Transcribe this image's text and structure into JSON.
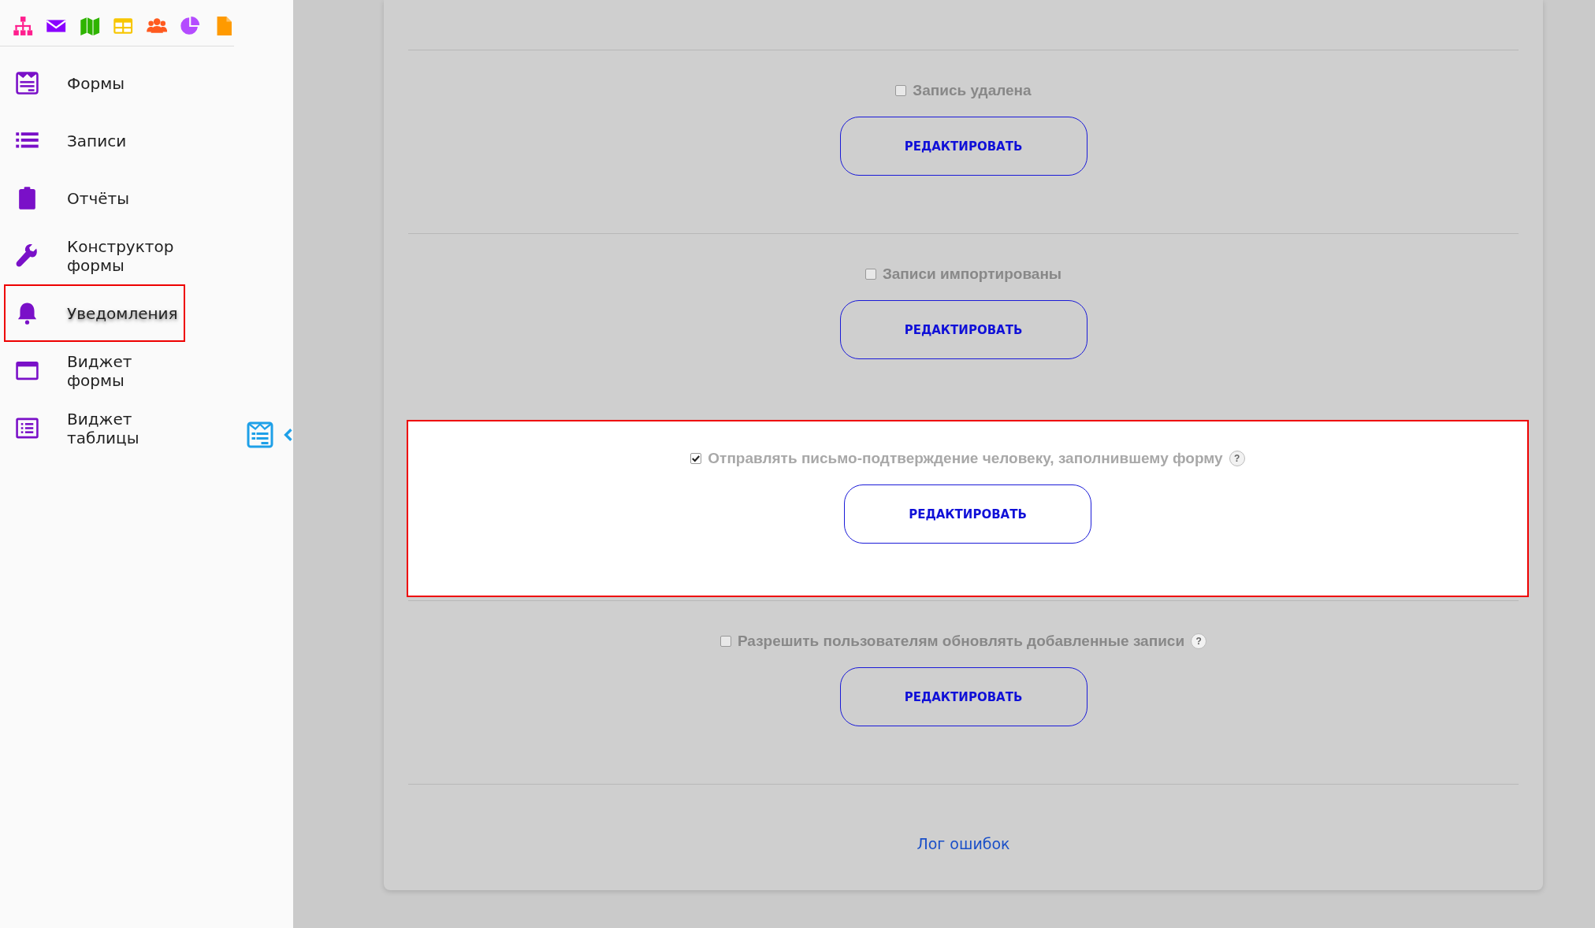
{
  "sidebar": {
    "apps": [
      {
        "kind": "sitemap",
        "color": "#ff1f8e"
      },
      {
        "kind": "mail",
        "color": "#8a00ff"
      },
      {
        "kind": "map",
        "color": "#2fb400"
      },
      {
        "kind": "table",
        "color": "#f7c600"
      },
      {
        "kind": "users",
        "color": "#ff5a1f"
      },
      {
        "kind": "pie",
        "color": "#b44cff"
      },
      {
        "kind": "file",
        "color": "#ff9a00"
      }
    ],
    "items": [
      {
        "kind": "form",
        "label": "Формы",
        "highlighted": false
      },
      {
        "kind": "list",
        "label": "Записи",
        "highlighted": false
      },
      {
        "kind": "clipboard",
        "label": "Отчёты",
        "highlighted": false
      },
      {
        "kind": "wrench",
        "label": "Конструктор формы",
        "highlighted": false
      },
      {
        "kind": "bell",
        "label": "Уведомления",
        "highlighted": true
      },
      {
        "kind": "window",
        "label": "Виджет формы",
        "highlighted": false
      },
      {
        "kind": "table-list",
        "label": "Виджет таблицы",
        "highlighted": false
      }
    ]
  },
  "sections": [
    {
      "label": "Запись удалена",
      "checked": false,
      "help": false,
      "highlighted": false,
      "button": "РЕДАКТИРОВАТЬ"
    },
    {
      "label": "Записи импортированы",
      "checked": false,
      "help": false,
      "highlighted": false,
      "button": "РЕДАКТИРОВАТЬ"
    },
    {
      "label": "Отправлять письмо-подтверждение человеку, заполнившему форму",
      "checked": true,
      "help": true,
      "highlighted": true,
      "button": "РЕДАКТИРОВАТЬ"
    },
    {
      "label": "Разрешить пользователям обновлять добавленные записи",
      "checked": false,
      "help": true,
      "highlighted": false,
      "button": "РЕДАКТИРОВАТЬ"
    }
  ],
  "error_log_link": "Лог ошибок",
  "help_mark": "?"
}
